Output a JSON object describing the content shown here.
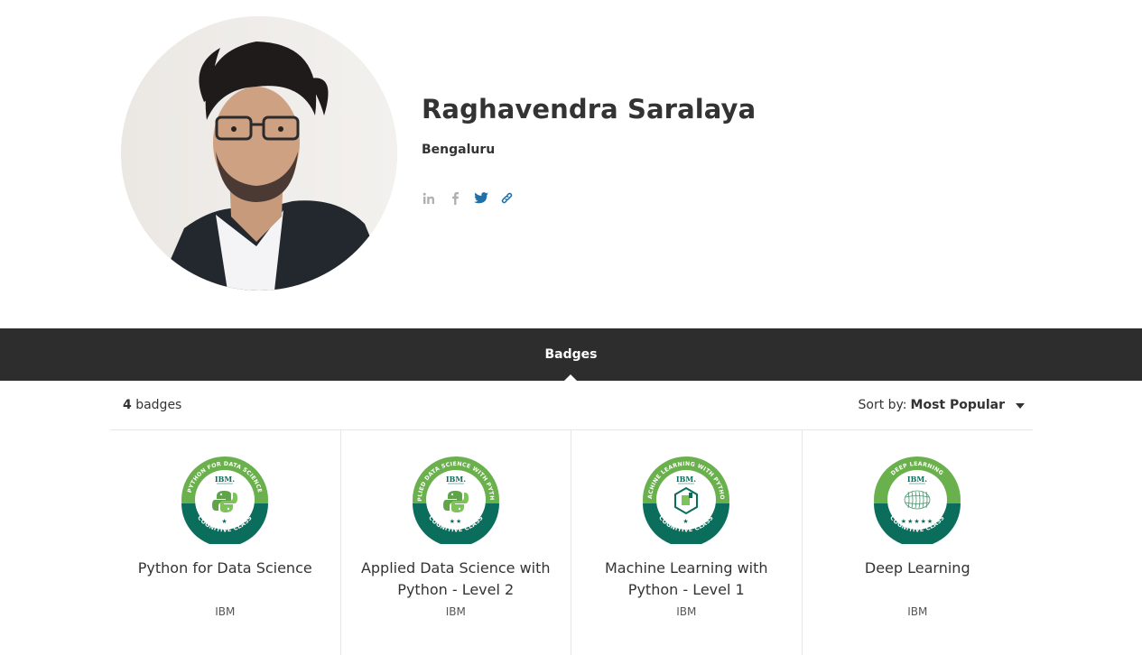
{
  "profile": {
    "name": "Raghavendra Saralaya",
    "location": "Bengaluru",
    "socials": [
      {
        "icon": "linkedin-icon",
        "color": "#b0b0b0"
      },
      {
        "icon": "facebook-icon",
        "color": "#b0b0b0"
      },
      {
        "icon": "twitter-icon",
        "color": "#1f6fa8"
      },
      {
        "icon": "link-icon",
        "color": "#1f6fa8"
      }
    ]
  },
  "tabs": {
    "active": "Badges"
  },
  "listing": {
    "count": "4",
    "count_suffix": "badges",
    "sort_label": "Sort by:",
    "sort_value": "Most Popular"
  },
  "badges": [
    {
      "title": "Python for Data Science",
      "issuer": "IBM",
      "ring_text": "PYTHON FOR DATA SCIENCE",
      "stars": "★",
      "icon": "python-logo-icon"
    },
    {
      "title": "Applied Data Science with Python - Level 2",
      "issuer": "IBM",
      "ring_text": "APPLIED DATA SCIENCE WITH PYTHON",
      "stars": "★★",
      "icon": "python-logo-icon"
    },
    {
      "title": "Machine Learning with Python - Level 1",
      "issuer": "IBM",
      "ring_text": "MACHINE LEARNING WITH PYTHON",
      "stars": "★",
      "icon": "ml-cube-icon"
    },
    {
      "title": "Deep Learning",
      "issuer": "IBM",
      "ring_text": "DEEP LEARNING",
      "stars": "★★★★★",
      "icon": "brain-icon"
    }
  ],
  "badge_common": {
    "brand": "IBM.",
    "bottom_text": "COGNITIVE CLASS",
    "colors": {
      "ring_light": "#6ab04c",
      "ring_dark": "#0b6e5c",
      "center": "#ffffff"
    }
  }
}
